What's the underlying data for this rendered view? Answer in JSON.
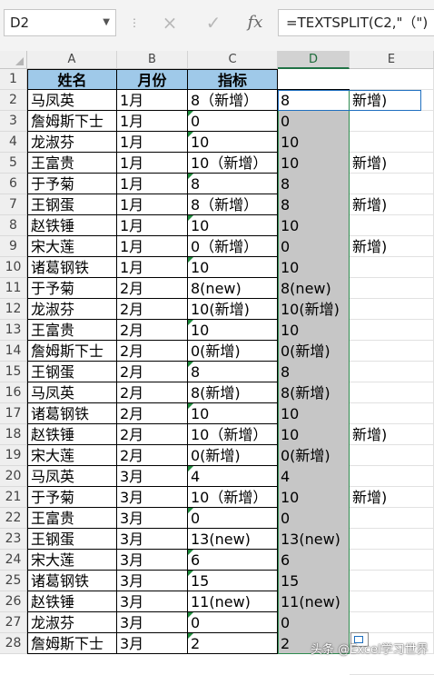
{
  "formula_bar": {
    "name_box": "D2",
    "cancel_icon": "×",
    "enter_icon": "✓",
    "fx_label": "fx",
    "formula": "=TEXTSPLIT(C2,\"（\")"
  },
  "columns": [
    "A",
    "B",
    "C",
    "D",
    "E"
  ],
  "header_row": {
    "row": "1",
    "name": "姓名",
    "month": "月份",
    "metric": "指标"
  },
  "rows": [
    {
      "row": "2",
      "name": "马凤英",
      "month": "1月",
      "metric": "8（新增）",
      "d": "8",
      "e": "新增)"
    },
    {
      "row": "3",
      "name": "詹姆斯下士",
      "month": "1月",
      "metric": "0",
      "d": "0",
      "e": ""
    },
    {
      "row": "4",
      "name": "龙淑芬",
      "month": "1月",
      "metric": "10",
      "d": "10",
      "e": ""
    },
    {
      "row": "5",
      "name": "王富贵",
      "month": "1月",
      "metric": "10（新增）",
      "d": "10",
      "e": "新增)"
    },
    {
      "row": "6",
      "name": "于予菊",
      "month": "1月",
      "metric": "8",
      "d": "8",
      "e": ""
    },
    {
      "row": "7",
      "name": "王钢蛋",
      "month": "1月",
      "metric": "8（新增）",
      "d": "8",
      "e": "新增)"
    },
    {
      "row": "8",
      "name": "赵铁锤",
      "month": "1月",
      "metric": "10",
      "d": "10",
      "e": ""
    },
    {
      "row": "9",
      "name": "宋大莲",
      "month": "1月",
      "metric": "0（新增）",
      "d": "0",
      "e": "新增)"
    },
    {
      "row": "10",
      "name": "诸葛钢铁",
      "month": "1月",
      "metric": "10",
      "d": "10",
      "e": ""
    },
    {
      "row": "11",
      "name": "于予菊",
      "month": "2月",
      "metric": "8(new)",
      "d": "8(new)",
      "e": ""
    },
    {
      "row": "12",
      "name": "龙淑芬",
      "month": "2月",
      "metric": "10(新增)",
      "d": "10(新增)",
      "e": ""
    },
    {
      "row": "13",
      "name": "王富贵",
      "month": "2月",
      "metric": "10",
      "d": "10",
      "e": ""
    },
    {
      "row": "14",
      "name": "詹姆斯下士",
      "month": "2月",
      "metric": "0(新增)",
      "d": "0(新增)",
      "e": ""
    },
    {
      "row": "15",
      "name": "王钢蛋",
      "month": "2月",
      "metric": "8",
      "d": "8",
      "e": ""
    },
    {
      "row": "16",
      "name": "马凤英",
      "month": "2月",
      "metric": "8(新增)",
      "d": "8(新增)",
      "e": ""
    },
    {
      "row": "17",
      "name": "诸葛钢铁",
      "month": "2月",
      "metric": "10",
      "d": "10",
      "e": ""
    },
    {
      "row": "18",
      "name": "赵铁锤",
      "month": "2月",
      "metric": "10（新增）",
      "d": "10",
      "e": "新增)"
    },
    {
      "row": "19",
      "name": "宋大莲",
      "month": "2月",
      "metric": "0(新增)",
      "d": "0(新增)",
      "e": ""
    },
    {
      "row": "20",
      "name": "马凤英",
      "month": "3月",
      "metric": "4",
      "d": "4",
      "e": ""
    },
    {
      "row": "21",
      "name": "于予菊",
      "month": "3月",
      "metric": "10（新增）",
      "d": "10",
      "e": "新增)"
    },
    {
      "row": "22",
      "name": "王富贵",
      "month": "3月",
      "metric": "0",
      "d": "0",
      "e": ""
    },
    {
      "row": "23",
      "name": "王钢蛋",
      "month": "3月",
      "metric": "13(new)",
      "d": "13(new)",
      "e": ""
    },
    {
      "row": "24",
      "name": "宋大莲",
      "month": "3月",
      "metric": "6",
      "d": "6",
      "e": ""
    },
    {
      "row": "25",
      "name": "诸葛钢铁",
      "month": "3月",
      "metric": "15",
      "d": "15",
      "e": ""
    },
    {
      "row": "26",
      "name": "赵铁锤",
      "month": "3月",
      "metric": "11(new)",
      "d": "11(new)",
      "e": ""
    },
    {
      "row": "27",
      "name": "龙淑芬",
      "month": "3月",
      "metric": "0",
      "d": "0",
      "e": ""
    },
    {
      "row": "28",
      "name": "詹姆斯下士",
      "month": "3月",
      "metric": "2",
      "d": "2",
      "e": ""
    }
  ],
  "watermark": "头条 @Excel学习世界",
  "colors": {
    "header_fill": "#9fc9e9",
    "spill_fill": "#c6c6c6",
    "spill_border": "#2e8b4f",
    "active_border": "#1f6fbf"
  }
}
